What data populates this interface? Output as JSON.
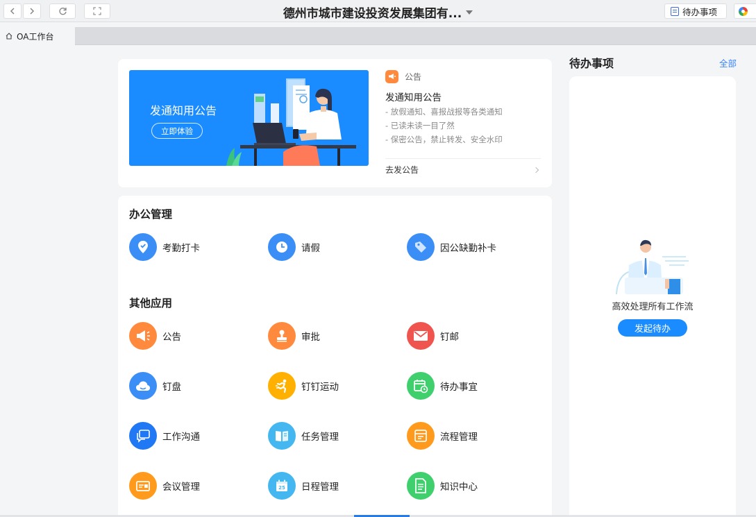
{
  "window": {
    "title": "德州市城市建设投资发展集团有...",
    "todo_button": "待办事项"
  },
  "tabs": [
    {
      "label": "OA工作台"
    }
  ],
  "announcement": {
    "banner_title": "发通知用公告",
    "banner_button": "立即体验",
    "tag": "公告",
    "heading": "发通知用公告",
    "items": [
      "- 放假通知、喜报战报等各类通知",
      "- 已读未读一目了然",
      "- 保密公告，禁止转发、安全水印"
    ],
    "link": "去发公告"
  },
  "office": {
    "title": "办公管理",
    "apps": [
      {
        "label": "考勤打卡",
        "icon": "location-check-icon",
        "color": "#3a8ef6"
      },
      {
        "label": "请假",
        "icon": "clock-icon",
        "color": "#3a8ef6"
      },
      {
        "label": "因公缺勤补卡",
        "icon": "tag-icon",
        "color": "#3a8ef6"
      }
    ]
  },
  "other": {
    "title": "其他应用",
    "apps": [
      {
        "label": "公告",
        "icon": "megaphone-icon",
        "color": "#ff8a3d"
      },
      {
        "label": "审批",
        "icon": "stamp-icon",
        "color": "#ff8a3d"
      },
      {
        "label": "钉邮",
        "icon": "mail-icon",
        "color": "#f0544f"
      },
      {
        "label": "钉盘",
        "icon": "cloud-icon",
        "color": "#3a8ef6"
      },
      {
        "label": "钉钉运动",
        "icon": "runner-icon",
        "color": "#ffb000"
      },
      {
        "label": "待办事宜",
        "icon": "calendar-clock-icon",
        "color": "#3fcf6c"
      },
      {
        "label": "工作沟通",
        "icon": "chat-icon",
        "color": "#2178f4"
      },
      {
        "label": "任务管理",
        "icon": "book-icon",
        "color": "#44b7f0"
      },
      {
        "label": "流程管理",
        "icon": "folder-icon",
        "color": "#ff9a1c"
      },
      {
        "label": "会议管理",
        "icon": "meeting-icon",
        "color": "#ff9a1c"
      },
      {
        "label": "日程管理",
        "icon": "calendar-icon",
        "color": "#44b7f0"
      },
      {
        "label": "知识中心",
        "icon": "document-icon",
        "color": "#3fcf6c"
      }
    ]
  },
  "todo": {
    "heading": "待办事项",
    "all_link": "全部",
    "description": "高效处理所有工作流",
    "button": "发起待办"
  },
  "colors": {
    "primary": "#1a8cff",
    "background": "#f4f5f7"
  }
}
